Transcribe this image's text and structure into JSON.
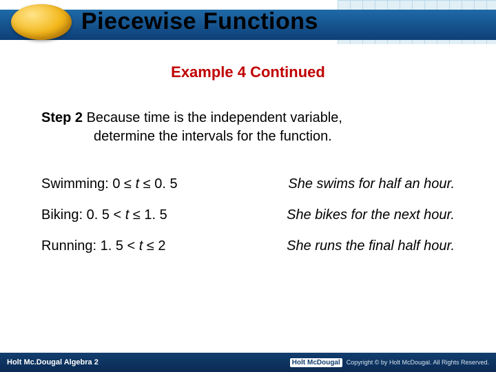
{
  "header": {
    "title": "Piecewise Functions"
  },
  "subtitle": "Example 4 Continued",
  "step": {
    "label": "Step 2",
    "text_line1": "Because time is the independent variable,",
    "text_line2": "determine the intervals for the function."
  },
  "rows": [
    {
      "activity": "Swimming:",
      "interval_pre": "0 ≤ ",
      "var": "t",
      "interval_post": " ≤ 0. 5",
      "desc": "She swims for half an hour."
    },
    {
      "activity": "Biking:",
      "interval_pre": "0. 5 < ",
      "var": "t",
      "interval_post": " ≤ 1. 5",
      "desc": "She bikes for the next hour."
    },
    {
      "activity": "Running:",
      "interval_pre": "1. 5 < ",
      "var": "t",
      "interval_post": " ≤ 2",
      "desc": "She runs the final half hour."
    }
  ],
  "footer": {
    "left": "Holt Mc.Dougal Algebra 2",
    "logo": "Holt McDougal",
    "copyright": "Copyright © by Holt McDougal. All Rights Reserved."
  }
}
